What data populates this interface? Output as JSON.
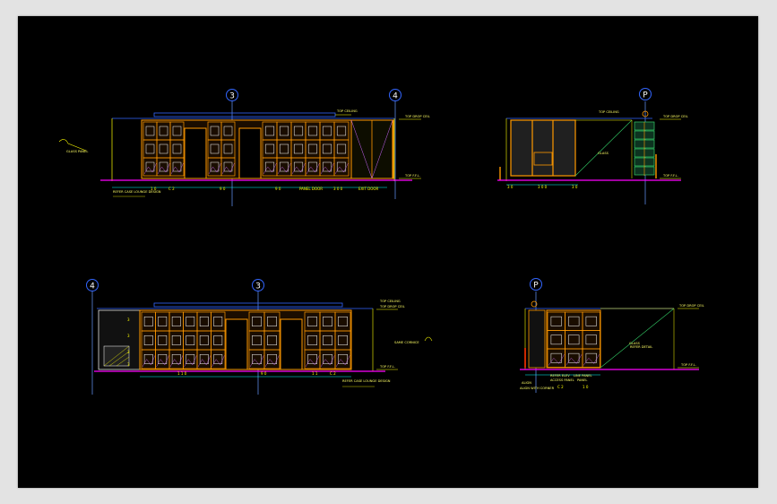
{
  "colors": {
    "background": "#000000",
    "frame_bg": "#e3e3e3",
    "wall": "#ff9900",
    "line": "#ffff00",
    "floor": "#ff00ff",
    "gridline": "#6699ff",
    "bubble": "#3366ff",
    "marble": "#cc66ff",
    "cyan": "#00ffff",
    "green": "#33cc66"
  },
  "bubbles": {
    "e1_left": "3",
    "e1_right": "4",
    "e2": "P",
    "e3_left": "4",
    "e3_mid": "3",
    "e4": "P"
  },
  "labels": {
    "e1_callout": "GLASS PANEL",
    "e1_ceiling": "TOP CEILING",
    "e1_level_top": "TOP DROP CEIL",
    "e1_level_fl": "TOP F.F.L.",
    "e2_level_top": "TOP DROP CEIL",
    "e2_level_fl": "TOP F.F.L.",
    "e2_ceiling": "TOP CEILING",
    "e3_ceiling": "TOP CEILING",
    "e3_level_top": "TOP DROP CEIL",
    "e3_level_fl": "TOP F.F.L.",
    "e3_callout": "SAME CORNICE",
    "e4_level_top": "TOP DROP CEIL",
    "e4_level_fl": "TOP F.F.L.",
    "e4_detail": "REFER DETAIL"
  },
  "dims": {
    "e1": [
      "1 0",
      "C 2",
      "9 0",
      "9 0",
      "PANEL DOOR",
      "3 0 0",
      "EXIT DOOR"
    ],
    "e1_note": "REFER CASE LOUNGE DESIGN",
    "e2": [
      "3 0",
      "3 0 0",
      "3 0"
    ],
    "e3_left": "1 1 0",
    "e3_mid": "9 0",
    "e3_right": [
      "1 1",
      "C 2"
    ],
    "e3_note": "REFER CASE LOUNGE DESIGN",
    "e3_side": [
      "3",
      "3",
      "3",
      "3"
    ],
    "e4_notes": [
      "ALIGN",
      "ALIGN WITH CORNER",
      "REFER ELEV",
      "ACCESS PANEL",
      "LINE PANEL",
      "PANEL"
    ],
    "e4_values": [
      "C 2",
      "1 0"
    ]
  }
}
